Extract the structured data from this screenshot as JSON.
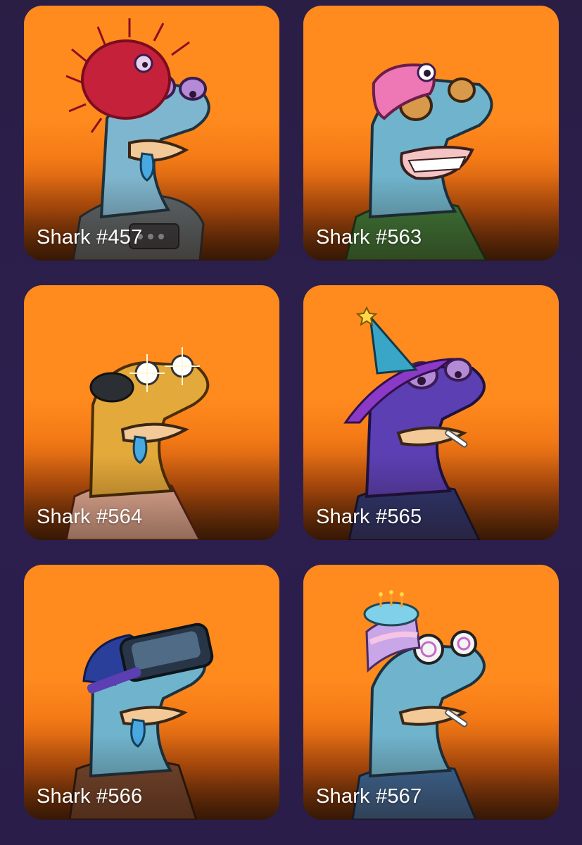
{
  "cards": [
    {
      "name": "Shark #457",
      "avatar": "shark-avatar"
    },
    {
      "name": "Shark #563",
      "avatar": "shark-avatar"
    },
    {
      "name": "Shark #564",
      "avatar": "shark-avatar"
    },
    {
      "name": "Shark #565",
      "avatar": "shark-avatar"
    },
    {
      "name": "Shark #566",
      "avatar": "shark-avatar"
    },
    {
      "name": "Shark #567",
      "avatar": "shark-avatar"
    }
  ],
  "colors": {
    "background": "#2a1e45",
    "card": "#ff8a1e",
    "label": "#ffffff"
  }
}
